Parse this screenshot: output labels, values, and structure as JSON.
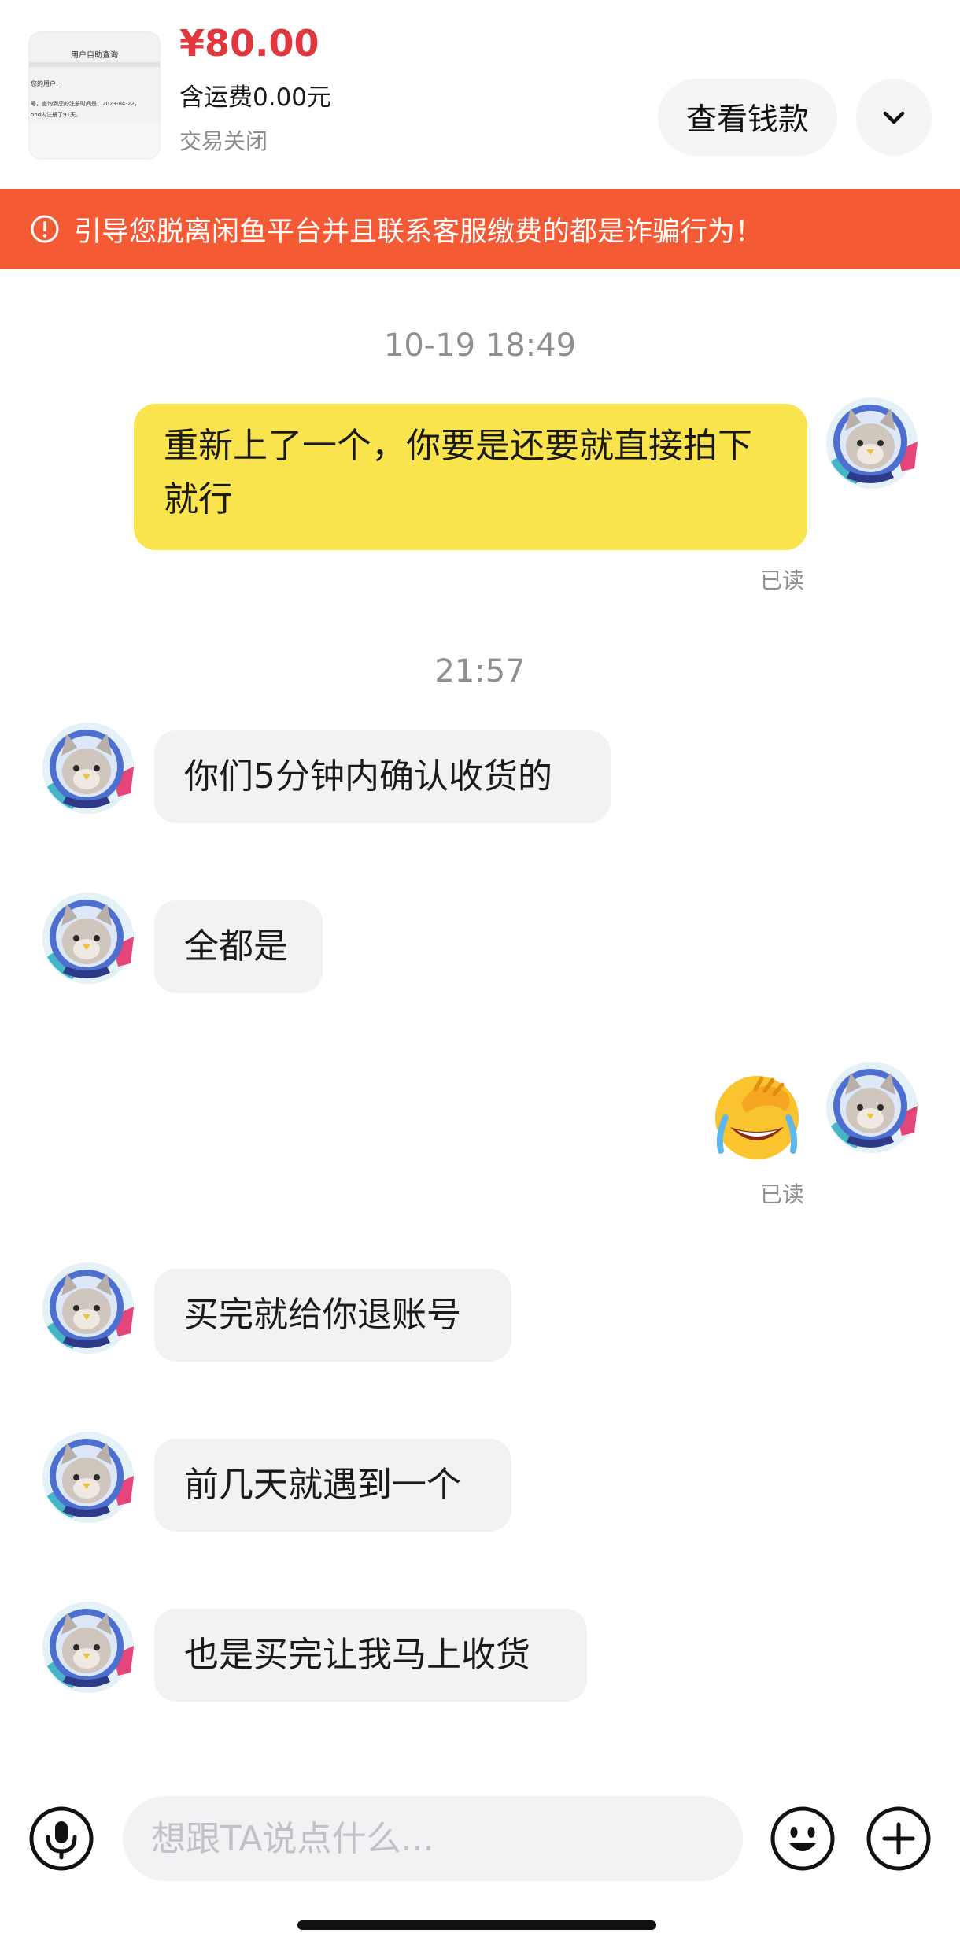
{
  "product": {
    "thumbnail_title": "用户自助查询",
    "thumbnail_line1": "您的用户:",
    "thumbnail_line2": "号，查询到您的注册时间是：2023-04-22，",
    "thumbnail_line3": "ond内注册了91天。",
    "price": "¥80.00",
    "shipping": "含运费0.00元",
    "status": "交易关闭",
    "view_button_label": "查看钱款",
    "expand_icon": "chevron-down-icon"
  },
  "warning_banner": {
    "icon": "exclamation-circle-icon",
    "text": "引导您脱离闲鱼平台并且联系客服缴费的都是诈骗行为！",
    "color": "#f45b35"
  },
  "chat": {
    "timestamps": [
      "10-19 18:49",
      "21:57"
    ],
    "messages": [
      {
        "direction": "outgoing",
        "text": "重新上了一个，你要是还要就直接拍下就行",
        "read_status": "已读"
      },
      {
        "direction": "incoming",
        "text": "你们5分钟内确认收货的"
      },
      {
        "direction": "incoming",
        "text": "全都是"
      },
      {
        "direction": "outgoing",
        "emoji": "facepalm-laughing-emoji",
        "read_status": "已读"
      },
      {
        "direction": "incoming",
        "text": "买完就给你退账号"
      },
      {
        "direction": "incoming",
        "text": "前几天就遇到一个"
      },
      {
        "direction": "incoming",
        "text": "也是买完让我马上收货"
      }
    ],
    "outgoing_bubble_color": "#fae44d",
    "incoming_bubble_color": "#f2f2f4"
  },
  "input_bar": {
    "voice_icon": "microphone-icon",
    "placeholder": "想跟TA说点什么...",
    "emoji_icon": "smiley-icon",
    "add_icon": "plus-icon"
  }
}
